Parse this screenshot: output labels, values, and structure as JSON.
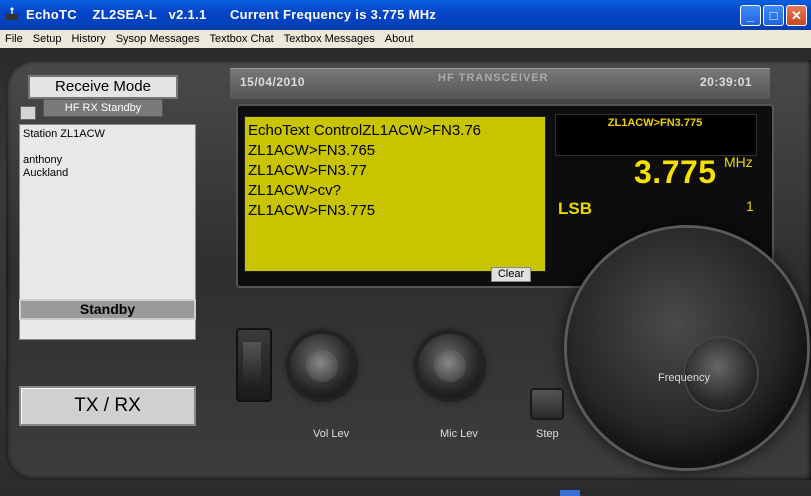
{
  "window": {
    "title": "EchoTC    ZL2SEA-L   v2.1.1      Current Frequency is 3.775 MHz",
    "minimize_icon": "minimize-icon",
    "maximize_icon": "maximize-icon",
    "close_icon": "close-icon"
  },
  "menu": {
    "items": [
      "File",
      "Setup",
      "History",
      "Sysop Messages",
      "Textbox Chat",
      "Textbox Messages",
      "About"
    ]
  },
  "radio": {
    "date": "15/04/2010",
    "brand_label": "HF TRANSCEIVER",
    "time": "20:39:01"
  },
  "left_panel": {
    "mode_title": "Receive Mode",
    "hf_status": "HF  RX  Standby",
    "station_lines": [
      "Station ZL1ACW",
      "",
      "anthony",
      "Auckland"
    ],
    "standby_label": "Standby",
    "txrx_label": "TX / RX"
  },
  "messages": {
    "lines": [
      "EchoText ControlZL1ACW>FN3.76",
      "ZL1ACW>FN3.765",
      "ZL1ACW>FN3.77",
      "ZL1ACW>cv?",
      "ZL1ACW>FN3.775"
    ],
    "clear_label": "Clear"
  },
  "display": {
    "callsign": "ZL1ACW>FN3.775",
    "frequency": "3.775",
    "unit": "MHz",
    "mode": "LSB",
    "channel": "1"
  },
  "controls": {
    "vol_label": "Vol Lev",
    "mic_label": "Mic Lev",
    "step_label": "Step",
    "frequency_label": "Frequency"
  },
  "colors": {
    "accent_yellow": "#f5e000",
    "message_bg": "#c9c400",
    "titlebar_blue": "#0545c8"
  }
}
